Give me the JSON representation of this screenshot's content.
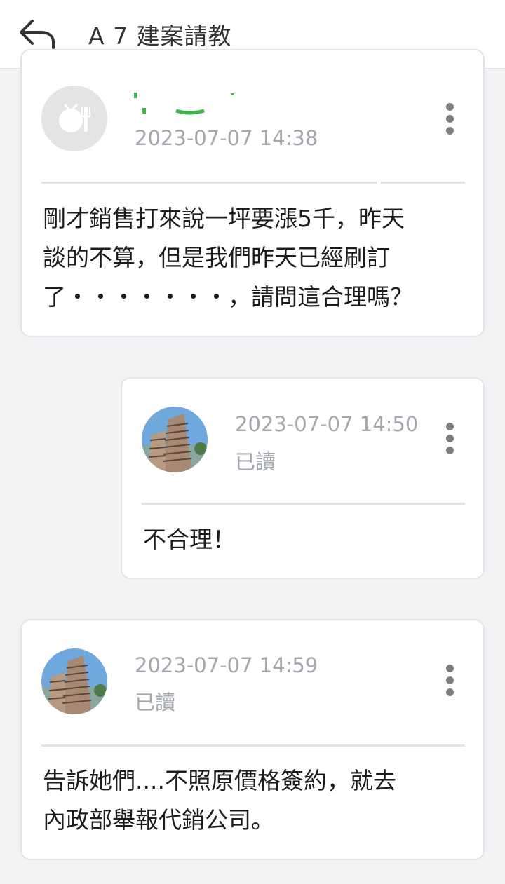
{
  "header": {
    "title": "A 7 建案請教",
    "back_icon": "back-arrow-icon"
  },
  "messages": [
    {
      "avatar": "fork-knife-placeholder",
      "time": "2023-07-07 14:38",
      "read": "",
      "text": "剛才銷售打來說一坪要漲5千，昨天\n談的不算，但是我們昨天已經刷訂\n了・・・・・・・，請問這合理嗎？"
    },
    {
      "avatar": "building-photo",
      "time": "2023-07-07 14:50",
      "read": "已讀",
      "text": "不合理！"
    },
    {
      "avatar": "building-photo",
      "time": "2023-07-07 14:59",
      "read": "已讀",
      "text": "告訴她們....不照原價格簽約，就去\n內政部舉報代銷公司。"
    }
  ],
  "colors": {
    "background": "#f2f3f5",
    "card": "#ffffff",
    "timestamp": "#a3a8ae",
    "name_redaction": "#3bb54a"
  }
}
